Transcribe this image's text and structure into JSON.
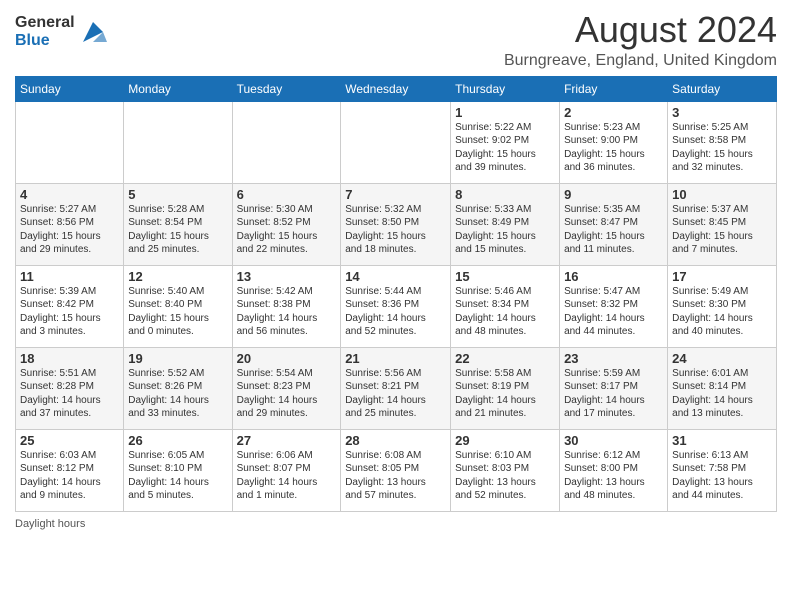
{
  "logo": {
    "general": "General",
    "blue": "Blue"
  },
  "header": {
    "month_year": "August 2024",
    "location": "Burngreave, England, United Kingdom"
  },
  "days_of_week": [
    "Sunday",
    "Monday",
    "Tuesday",
    "Wednesday",
    "Thursday",
    "Friday",
    "Saturday"
  ],
  "footer": {
    "daylight_hours": "Daylight hours"
  },
  "weeks": [
    {
      "days": [
        {
          "number": "",
          "info": ""
        },
        {
          "number": "",
          "info": ""
        },
        {
          "number": "",
          "info": ""
        },
        {
          "number": "",
          "info": ""
        },
        {
          "number": "1",
          "info": "Sunrise: 5:22 AM\nSunset: 9:02 PM\nDaylight: 15 hours\nand 39 minutes."
        },
        {
          "number": "2",
          "info": "Sunrise: 5:23 AM\nSunset: 9:00 PM\nDaylight: 15 hours\nand 36 minutes."
        },
        {
          "number": "3",
          "info": "Sunrise: 5:25 AM\nSunset: 8:58 PM\nDaylight: 15 hours\nand 32 minutes."
        }
      ]
    },
    {
      "days": [
        {
          "number": "4",
          "info": "Sunrise: 5:27 AM\nSunset: 8:56 PM\nDaylight: 15 hours\nand 29 minutes."
        },
        {
          "number": "5",
          "info": "Sunrise: 5:28 AM\nSunset: 8:54 PM\nDaylight: 15 hours\nand 25 minutes."
        },
        {
          "number": "6",
          "info": "Sunrise: 5:30 AM\nSunset: 8:52 PM\nDaylight: 15 hours\nand 22 minutes."
        },
        {
          "number": "7",
          "info": "Sunrise: 5:32 AM\nSunset: 8:50 PM\nDaylight: 15 hours\nand 18 minutes."
        },
        {
          "number": "8",
          "info": "Sunrise: 5:33 AM\nSunset: 8:49 PM\nDaylight: 15 hours\nand 15 minutes."
        },
        {
          "number": "9",
          "info": "Sunrise: 5:35 AM\nSunset: 8:47 PM\nDaylight: 15 hours\nand 11 minutes."
        },
        {
          "number": "10",
          "info": "Sunrise: 5:37 AM\nSunset: 8:45 PM\nDaylight: 15 hours\nand 7 minutes."
        }
      ]
    },
    {
      "days": [
        {
          "number": "11",
          "info": "Sunrise: 5:39 AM\nSunset: 8:42 PM\nDaylight: 15 hours\nand 3 minutes."
        },
        {
          "number": "12",
          "info": "Sunrise: 5:40 AM\nSunset: 8:40 PM\nDaylight: 15 hours\nand 0 minutes."
        },
        {
          "number": "13",
          "info": "Sunrise: 5:42 AM\nSunset: 8:38 PM\nDaylight: 14 hours\nand 56 minutes."
        },
        {
          "number": "14",
          "info": "Sunrise: 5:44 AM\nSunset: 8:36 PM\nDaylight: 14 hours\nand 52 minutes."
        },
        {
          "number": "15",
          "info": "Sunrise: 5:46 AM\nSunset: 8:34 PM\nDaylight: 14 hours\nand 48 minutes."
        },
        {
          "number": "16",
          "info": "Sunrise: 5:47 AM\nSunset: 8:32 PM\nDaylight: 14 hours\nand 44 minutes."
        },
        {
          "number": "17",
          "info": "Sunrise: 5:49 AM\nSunset: 8:30 PM\nDaylight: 14 hours\nand 40 minutes."
        }
      ]
    },
    {
      "days": [
        {
          "number": "18",
          "info": "Sunrise: 5:51 AM\nSunset: 8:28 PM\nDaylight: 14 hours\nand 37 minutes."
        },
        {
          "number": "19",
          "info": "Sunrise: 5:52 AM\nSunset: 8:26 PM\nDaylight: 14 hours\nand 33 minutes."
        },
        {
          "number": "20",
          "info": "Sunrise: 5:54 AM\nSunset: 8:23 PM\nDaylight: 14 hours\nand 29 minutes."
        },
        {
          "number": "21",
          "info": "Sunrise: 5:56 AM\nSunset: 8:21 PM\nDaylight: 14 hours\nand 25 minutes."
        },
        {
          "number": "22",
          "info": "Sunrise: 5:58 AM\nSunset: 8:19 PM\nDaylight: 14 hours\nand 21 minutes."
        },
        {
          "number": "23",
          "info": "Sunrise: 5:59 AM\nSunset: 8:17 PM\nDaylight: 14 hours\nand 17 minutes."
        },
        {
          "number": "24",
          "info": "Sunrise: 6:01 AM\nSunset: 8:14 PM\nDaylight: 14 hours\nand 13 minutes."
        }
      ]
    },
    {
      "days": [
        {
          "number": "25",
          "info": "Sunrise: 6:03 AM\nSunset: 8:12 PM\nDaylight: 14 hours\nand 9 minutes."
        },
        {
          "number": "26",
          "info": "Sunrise: 6:05 AM\nSunset: 8:10 PM\nDaylight: 14 hours\nand 5 minutes."
        },
        {
          "number": "27",
          "info": "Sunrise: 6:06 AM\nSunset: 8:07 PM\nDaylight: 14 hours\nand 1 minute."
        },
        {
          "number": "28",
          "info": "Sunrise: 6:08 AM\nSunset: 8:05 PM\nDaylight: 13 hours\nand 57 minutes."
        },
        {
          "number": "29",
          "info": "Sunrise: 6:10 AM\nSunset: 8:03 PM\nDaylight: 13 hours\nand 52 minutes."
        },
        {
          "number": "30",
          "info": "Sunrise: 6:12 AM\nSunset: 8:00 PM\nDaylight: 13 hours\nand 48 minutes."
        },
        {
          "number": "31",
          "info": "Sunrise: 6:13 AM\nSunset: 7:58 PM\nDaylight: 13 hours\nand 44 minutes."
        }
      ]
    }
  ]
}
